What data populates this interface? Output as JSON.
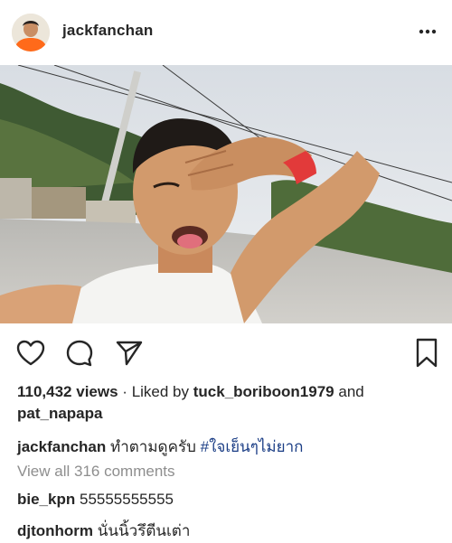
{
  "post": {
    "author": "jackfanchan",
    "more_icon": "more-horizontal-icon",
    "image_alt": "Man taking a selfie outdoors on a road, making a funny face"
  },
  "actions": {
    "like_icon": "heart-icon",
    "comment_icon": "comment-icon",
    "share_icon": "send-icon",
    "save_icon": "bookmark-icon"
  },
  "stats": {
    "views": "110,432 views",
    "separator": "·",
    "liked_by_prefix": "Liked by",
    "liked_by_user1": "tuck_boriboon1979",
    "and": "and",
    "liked_by_user2": "pat_napapa"
  },
  "caption": {
    "user": "jackfanchan",
    "text": "ทำตามดูครับ",
    "hashtag": "#ใจเย็นๆไม่ยาก"
  },
  "comments_link": "View all 316 comments",
  "comments": [
    {
      "user": "bie_kpn",
      "text": "55555555555"
    },
    {
      "user": "djtonhorm",
      "text": "นั่นนิ้วรึตีนเต่า"
    }
  ],
  "colors": {
    "text": "#262626",
    "muted": "#8e8e8e",
    "hashtag": "#1a3d85",
    "wristband": "#e23a3a"
  }
}
